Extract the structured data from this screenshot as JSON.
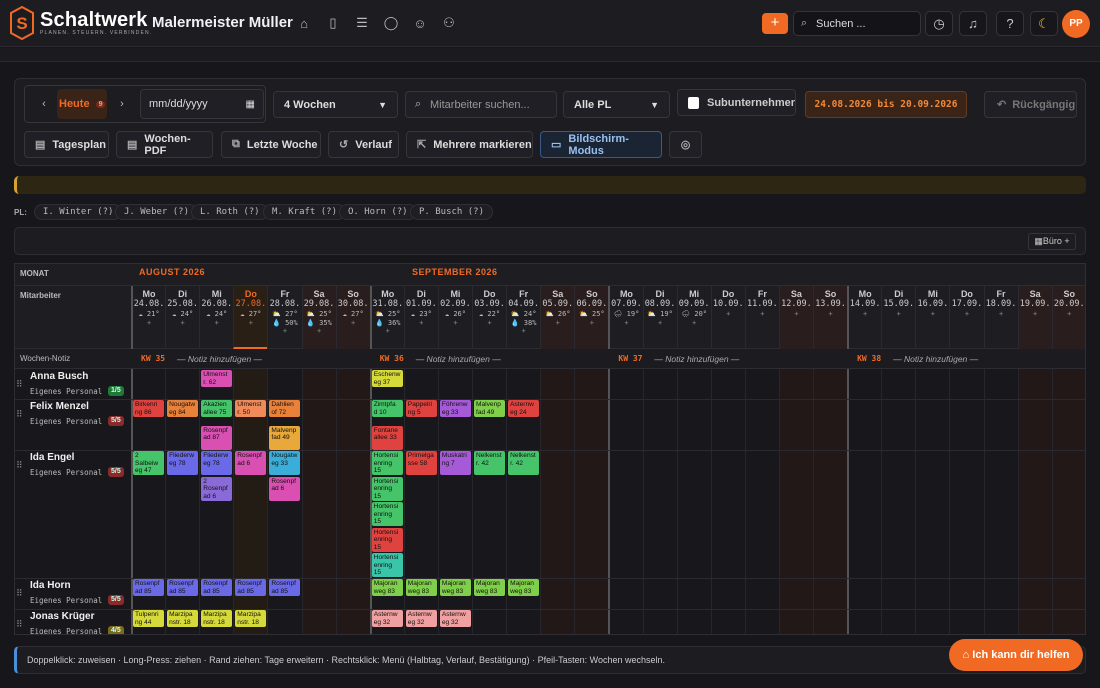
{
  "topbar": {
    "brand": "Schaltwerk",
    "tagline": "PLANEN. STEUERN. VERBINDEN.",
    "company": "Malermeister Müller",
    "nav_icons": [
      "home-icon",
      "document-icon",
      "checklist-icon",
      "chat-icon",
      "users-icon",
      "user-settings-icon"
    ],
    "add_label": "+",
    "search_placeholder": "Suchen ...",
    "avatar": "PP"
  },
  "toolbar": {
    "today_label": "Heute",
    "today_badge": "9",
    "date_placeholder": "mm/dd/yyyy",
    "weeks_select": "4 Wochen",
    "employee_search_placeholder": "Mitarbeiter suchen...",
    "pl_select": "Alle PL",
    "subunternehmer_label": "Subunternehmer",
    "range_label": "24.08.2026 bis 20.09.2026",
    "undo_label": "Rückgängig",
    "buttons": [
      "Tagesplan",
      "Wochen-PDF",
      "Letzte Woche",
      "Verlauf",
      "Mehrere markieren",
      "Bildschirm-Modus"
    ]
  },
  "pl": {
    "label": "PL:",
    "chips": [
      "I. Winter (?)",
      "J. Weber (?)",
      "L. Roth (?)",
      "M. Kraft (?)",
      "O. Horn (?)",
      "P. Busch (?)"
    ]
  },
  "buero_label": "Büro +",
  "grid": {
    "monat_label": "MONAT",
    "mitarbeiter_label": "Mitarbeiter",
    "notiz_label": "Wochen-Notiz",
    "months": [
      "AUGUST 2026",
      "SEPTEMBER 2026"
    ],
    "days": [
      {
        "n": "Mo",
        "d": "24.08.",
        "w": "☁ 21°",
        "rain": ""
      },
      {
        "n": "Di",
        "d": "25.08.",
        "w": "☁ 24°",
        "rain": ""
      },
      {
        "n": "Mi",
        "d": "26.08.",
        "w": "☁ 24°",
        "rain": ""
      },
      {
        "n": "Do",
        "d": "27.08.",
        "w": "☁ 27°",
        "rain": ""
      },
      {
        "n": "Fr",
        "d": "28.08.",
        "w": "⛅ 27°",
        "rain": "50%"
      },
      {
        "n": "Sa",
        "d": "29.08.",
        "w": "⛅ 25°",
        "rain": "35%"
      },
      {
        "n": "So",
        "d": "30.08.",
        "w": "☁ 27°",
        "rain": ""
      },
      {
        "n": "Mo",
        "d": "31.08.",
        "w": "⛅ 25°",
        "rain": "36%"
      },
      {
        "n": "Di",
        "d": "01.09.",
        "w": "☁ 23°",
        "rain": ""
      },
      {
        "n": "Mi",
        "d": "02.09.",
        "w": "☁ 26°",
        "rain": ""
      },
      {
        "n": "Do",
        "d": "03.09.",
        "w": "☁ 22°",
        "rain": ""
      },
      {
        "n": "Fr",
        "d": "04.09.",
        "w": "⛅ 24°",
        "rain": "38%"
      },
      {
        "n": "Sa",
        "d": "05.09.",
        "w": "⛅ 26°",
        "rain": ""
      },
      {
        "n": "So",
        "d": "06.09.",
        "w": "⛅ 25°",
        "rain": ""
      },
      {
        "n": "Mo",
        "d": "07.09.",
        "w": "🌧 19°",
        "rain": ""
      },
      {
        "n": "Di",
        "d": "08.09.",
        "w": "⛅ 19°",
        "rain": ""
      },
      {
        "n": "Mi",
        "d": "09.09.",
        "w": "🌧 20°",
        "rain": ""
      },
      {
        "n": "Do",
        "d": "10.09.",
        "w": "",
        "rain": ""
      },
      {
        "n": "Fr",
        "d": "11.09.",
        "w": "",
        "rain": ""
      },
      {
        "n": "Sa",
        "d": "12.09.",
        "w": "",
        "rain": ""
      },
      {
        "n": "So",
        "d": "13.09.",
        "w": "",
        "rain": ""
      },
      {
        "n": "Mo",
        "d": "14.09.",
        "w": "",
        "rain": ""
      },
      {
        "n": "Di",
        "d": "15.09.",
        "w": "",
        "rain": ""
      },
      {
        "n": "Mi",
        "d": "16.09.",
        "w": "",
        "rain": ""
      },
      {
        "n": "Do",
        "d": "17.09.",
        "w": "",
        "rain": ""
      },
      {
        "n": "Fr",
        "d": "18.09.",
        "w": "",
        "rain": ""
      },
      {
        "n": "Sa",
        "d": "19.09.",
        "w": "",
        "rain": ""
      },
      {
        "n": "So",
        "d": "20.09.",
        "w": "",
        "rain": ""
      }
    ],
    "weeks": [
      {
        "kw": "KW 35",
        "note": "— Notiz hinzufügen —"
      },
      {
        "kw": "KW 36",
        "note": "— Notiz hinzufügen —"
      },
      {
        "kw": "KW 37",
        "note": "— Notiz hinzufügen —"
      },
      {
        "kw": "KW 38",
        "note": "— Notiz hinzufügen —"
      }
    ],
    "employees": [
      {
        "name": "Anna Busch",
        "sub": "Eigenes Personal",
        "badge": "1/5",
        "badge_color": "#1f7a3a"
      },
      {
        "name": "Felix Menzel",
        "sub": "Eigenes Personal",
        "badge": "5/5",
        "badge_color": "#8a2a2a"
      },
      {
        "name": "Ida Engel",
        "sub": "Eigenes Personal",
        "badge": "5/5",
        "badge_color": "#8a2a2a"
      },
      {
        "name": "Ida Horn",
        "sub": "Eigenes Personal",
        "badge": "5/5",
        "badge_color": "#8a2a2a"
      },
      {
        "name": "Jonas Krüger",
        "sub": "Eigenes Personal",
        "badge": "4/5",
        "badge_color": "#7a6a1a"
      }
    ],
    "events": [
      {
        "day": 2,
        "row": 0,
        "y": 0,
        "text": "Ulmenst r. 62",
        "color": "#d94fb2"
      },
      {
        "day": 7,
        "row": 0,
        "y": 0,
        "text": "Eschenw eg 37",
        "color": "#d6d93a"
      },
      {
        "day": 0,
        "row": 1,
        "y": 0,
        "text": "Birkenri ng 86",
        "color": "#e0433f"
      },
      {
        "day": 1,
        "row": 1,
        "y": 0,
        "text": "Nougatw eg 84",
        "color": "#e8813a"
      },
      {
        "day": 2,
        "row": 1,
        "y": 0,
        "text": "Akazien allee 75",
        "color": "#46c46a"
      },
      {
        "day": 3,
        "row": 1,
        "y": 0,
        "text": "Ulmenst r. 50",
        "color": "#f08a5a"
      },
      {
        "day": 4,
        "row": 1,
        "y": 0,
        "text": "Dahlien of 72",
        "color": "#e8813a"
      },
      {
        "day": 7,
        "row": 1,
        "y": 0,
        "text": "Zimtpfa d 10",
        "color": "#46c46a"
      },
      {
        "day": 8,
        "row": 1,
        "y": 0,
        "text": "Pappelri ng 5",
        "color": "#e0433f"
      },
      {
        "day": 9,
        "row": 1,
        "y": 0,
        "text": "Föhrenw eg 33",
        "color": "#a65ad8"
      },
      {
        "day": 10,
        "row": 1,
        "y": 0,
        "text": "Malvenp fad 49",
        "color": "#7fcf4a"
      },
      {
        "day": 11,
        "row": 1,
        "y": 0,
        "text": "Asternw eg 24",
        "color": "#e0433f"
      },
      {
        "day": 2,
        "row": 1,
        "y": 1,
        "text": "Rosenpf ad 87",
        "color": "#d94fb2"
      },
      {
        "day": 4,
        "row": 1,
        "y": 1,
        "text": "Malvenp fad 49",
        "color": "#e8a83a"
      },
      {
        "day": 7,
        "row": 1,
        "y": 1,
        "text": "Fontane allee 33",
        "color": "#e0433f"
      },
      {
        "day": 0,
        "row": 2,
        "y": 0,
        "text": "2 Salbeiw eg 47",
        "color": "#46c46a"
      },
      {
        "day": 1,
        "row": 2,
        "y": 0,
        "text": "Fliederw eg 78",
        "color": "#6a6ae8"
      },
      {
        "day": 2,
        "row": 2,
        "y": 0,
        "text": "Fliederw eg 78",
        "color": "#6a6ae8"
      },
      {
        "day": 3,
        "row": 2,
        "y": 0,
        "text": "Rosenpf ad 6",
        "color": "#d94fb2"
      },
      {
        "day": 4,
        "row": 2,
        "y": 0,
        "text": "Nougatw eg 33",
        "color": "#3aaed8"
      },
      {
        "day": 7,
        "row": 2,
        "y": 0,
        "text": "Hortensi enring 15",
        "color": "#46c46a"
      },
      {
        "day": 8,
        "row": 2,
        "y": 0,
        "text": "Primelga sse 58",
        "color": "#e0433f"
      },
      {
        "day": 9,
        "row": 2,
        "y": 0,
        "text": "Muskatri ng 7",
        "color": "#a65ad8"
      },
      {
        "day": 10,
        "row": 2,
        "y": 0,
        "text": "Nelkenst r. 42",
        "color": "#46c46a"
      },
      {
        "day": 11,
        "row": 2,
        "y": 0,
        "text": "Nelkenst r. 42",
        "color": "#46c46a"
      },
      {
        "day": 2,
        "row": 2,
        "y": 1,
        "text": "2 Rosenpf ad 6",
        "color": "#8a6ad8"
      },
      {
        "day": 4,
        "row": 2,
        "y": 1,
        "text": "Rosenpf ad 6",
        "color": "#d94fb2"
      },
      {
        "day": 7,
        "row": 2,
        "y": 1,
        "text": "Hortensi enring 15",
        "color": "#46c46a"
      },
      {
        "day": 7,
        "row": 2,
        "y": 2,
        "text": "Hortensi enring 15",
        "color": "#46c46a"
      },
      {
        "day": 7,
        "row": 2,
        "y": 3,
        "text": "Hortensi enring 15",
        "color": "#e0433f"
      },
      {
        "day": 7,
        "row": 2,
        "y": 4,
        "text": "Hortensi enring 15",
        "color": "#3ac4a8"
      },
      {
        "day": 0,
        "row": 3,
        "y": 0,
        "text": "Rosenpf ad 85",
        "color": "#6a6ae8"
      },
      {
        "day": 1,
        "row": 3,
        "y": 0,
        "text": "Rosenpf ad 85",
        "color": "#6a6ae8"
      },
      {
        "day": 2,
        "row": 3,
        "y": 0,
        "text": "Rosenpf ad 85",
        "color": "#6a6ae8"
      },
      {
        "day": 3,
        "row": 3,
        "y": 0,
        "text": "Rosenpf ad 85",
        "color": "#6a6ae8"
      },
      {
        "day": 4,
        "row": 3,
        "y": 0,
        "text": "Rosenpf ad 85",
        "color": "#6a6ae8"
      },
      {
        "day": 7,
        "row": 3,
        "y": 0,
        "text": "Majoran weg 83",
        "color": "#7fcf4a"
      },
      {
        "day": 8,
        "row": 3,
        "y": 0,
        "text": "Majoran weg 83",
        "color": "#7fcf4a"
      },
      {
        "day": 9,
        "row": 3,
        "y": 0,
        "text": "Majoran weg 83",
        "color": "#7fcf4a"
      },
      {
        "day": 10,
        "row": 3,
        "y": 0,
        "text": "Majoran weg 83",
        "color": "#7fcf4a"
      },
      {
        "day": 11,
        "row": 3,
        "y": 0,
        "text": "Majoran weg 83",
        "color": "#7fcf4a"
      },
      {
        "day": 0,
        "row": 4,
        "y": 0,
        "text": "Tulpenri ng 44",
        "color": "#d6d93a"
      },
      {
        "day": 1,
        "row": 4,
        "y": 0,
        "text": "Marzipa nstr. 18",
        "color": "#d6d93a"
      },
      {
        "day": 2,
        "row": 4,
        "y": 0,
        "text": "Marzipa nstr. 18",
        "color": "#d6d93a"
      },
      {
        "day": 3,
        "row": 4,
        "y": 0,
        "text": "Marzipa nstr. 18",
        "color": "#d6d93a"
      },
      {
        "day": 7,
        "row": 4,
        "y": 0,
        "text": "Asternw eg 32",
        "color": "#f0a0a0"
      },
      {
        "day": 8,
        "row": 4,
        "y": 0,
        "text": "Asternw eg 32",
        "color": "#f0a0a0"
      },
      {
        "day": 9,
        "row": 4,
        "y": 0,
        "text": "Asternw eg 32",
        "color": "#f0a0a0"
      }
    ]
  },
  "footer": {
    "hint": "Doppelklick: zuweisen · Long-Press: ziehen · Rand ziehen: Tage erweitern · Rechtsklick: Menü (Halbtag, Verlauf, Bestätigung) · Pfeil-Tasten: Wochen wechseln.",
    "help_label": "Ich kann dir helfen"
  }
}
